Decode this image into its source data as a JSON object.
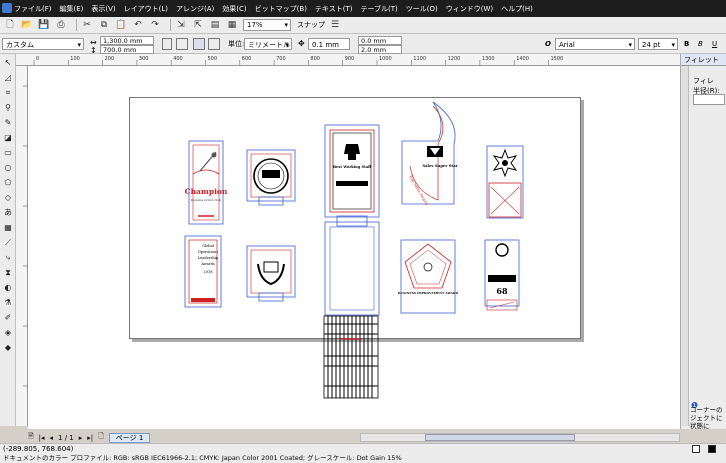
{
  "menubar": {
    "items": [
      "ファイル(F)",
      "編集(E)",
      "表示(V)",
      "レイアウト(L)",
      "アレンジ(A)",
      "効果(C)",
      "ビットマップ(B)",
      "テキスト(T)",
      "テーブル(T)",
      "ツール(O)",
      "ウィンドウ(W)",
      "ヘルプ(H)"
    ]
  },
  "toolbar": {
    "zoom": "17%",
    "snap_label": "スナップ"
  },
  "propbar": {
    "preset": "カスタム",
    "width": "1,300.0 mm",
    "height": "700.0 mm",
    "units_label": "単位:",
    "units": "ミリメートル",
    "nudge": "0.1 mm",
    "dup_x": "0.0 mm",
    "dup_y": "2.0 mm",
    "font": "Arial",
    "font_size": "24 pt"
  },
  "ruler": {
    "ticks": [
      "0",
      "100",
      "200",
      "300",
      "400",
      "500",
      "600",
      "700",
      "800",
      "900",
      "1000",
      "1100",
      "1200",
      "1300",
      "1400",
      "1500"
    ],
    "unit": "ミリメートル"
  },
  "docker": {
    "tab": "フィレット",
    "item": "フィレ",
    "radius_label": "半径(R):",
    "hint": "コーナーのジェクトに状態に"
  },
  "artwork": {
    "champion_title": "Champion",
    "champion_sub": "Karaoka Action Club",
    "leadership_lines": [
      "Global",
      "Operations",
      "Leadership",
      "Awards",
      "2018"
    ],
    "best_staff": "Best Working Staff",
    "sales_star": "Sales Super Star",
    "top_sales": "Top Sales Award",
    "business_award": "BUSINESS IMPROVEMENT AWARD",
    "number": "68"
  },
  "pagenav": {
    "count": "1 / 1",
    "page_tab": "ページ 1"
  },
  "status": {
    "coords": "(-289.805, 768.604)",
    "profile": "ドキュメントのカラー プロファイル: RGB: sRGB IEC61966-2.1; CMYK: Japan Color 2001 Coated; グレースケール: Dot Gain 15%"
  },
  "colors": {
    "menubar_bg": "#1d1d1d",
    "accent_red": "#cc2222",
    "outline_blue": "#3b5fd4"
  }
}
